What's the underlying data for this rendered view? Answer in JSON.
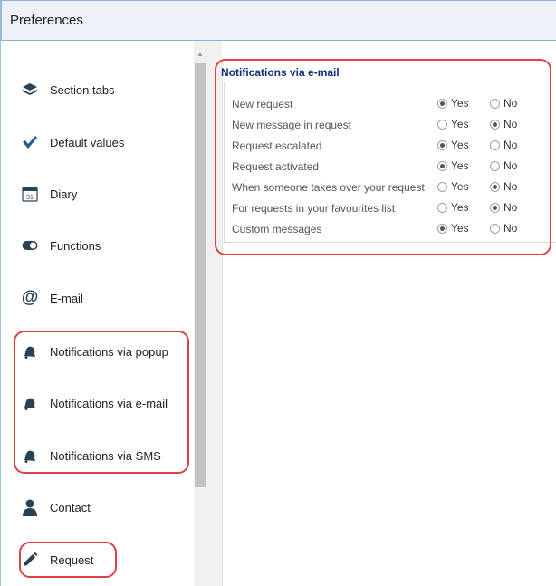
{
  "window": {
    "title": "Preferences"
  },
  "sidebar": {
    "items": [
      {
        "label": "Section tabs",
        "icon": "stack-icon"
      },
      {
        "label": "Default values",
        "icon": "checkmark-icon"
      },
      {
        "label": "Diary",
        "icon": "calendar-icon",
        "icon_text": "31"
      },
      {
        "label": "Functions",
        "icon": "toggle-icon"
      },
      {
        "label": "E-mail",
        "icon": "at-sign-icon",
        "icon_text": "@"
      },
      {
        "label": "Notifications via popup",
        "icon": "bell-icon"
      },
      {
        "label": "Notifications via e-mail",
        "icon": "bell-icon"
      },
      {
        "label": "Notifications via SMS",
        "icon": "bell-icon"
      },
      {
        "label": "Contact",
        "icon": "person-icon"
      },
      {
        "label": "Request",
        "icon": "pencil-icon"
      }
    ]
  },
  "main": {
    "section_title": "Notifications via e-mail",
    "yes_label": "Yes",
    "no_label": "No",
    "rows": [
      {
        "label": "New request",
        "value": "Yes"
      },
      {
        "label": "New message in request",
        "value": "No"
      },
      {
        "label": "Request escalated",
        "value": "Yes"
      },
      {
        "label": "Request activated",
        "value": "Yes"
      },
      {
        "label": "When someone takes over your request",
        "value": "No"
      },
      {
        "label": "For requests in your favourites list",
        "value": "No"
      },
      {
        "label": "Custom messages",
        "value": "Yes"
      }
    ]
  },
  "colors": {
    "highlight": "#e04242",
    "section_title": "#0f2f78",
    "titlebar_bg": "#edf2f8",
    "icon": "#2a4256"
  }
}
